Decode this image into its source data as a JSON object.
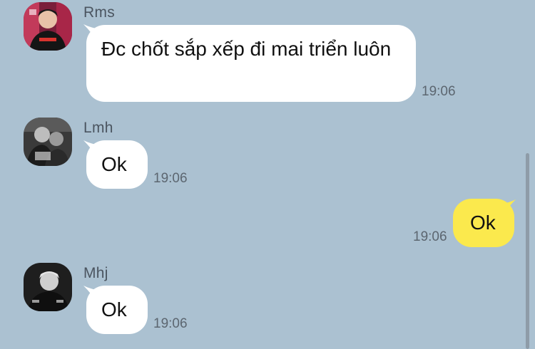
{
  "messages": [
    {
      "sender": "Rms",
      "text": "Đc chốt sắp xếp đi mai triển luôn",
      "time": "19:06",
      "direction": "incoming"
    },
    {
      "sender": "Lmh",
      "text": "Ok",
      "time": "19:06",
      "direction": "incoming"
    },
    {
      "sender": "",
      "text": "Ok",
      "time": "19:06",
      "direction": "outgoing"
    },
    {
      "sender": "Mhj",
      "text": "Ok",
      "time": "19:06",
      "direction": "incoming"
    }
  ],
  "colors": {
    "background": "#abc1d1",
    "incoming_bubble": "#ffffff",
    "outgoing_bubble": "#fbe94d"
  },
  "icons": {
    "avatar_rms": "avatar-photo",
    "avatar_lmh": "avatar-photo",
    "avatar_mhj": "avatar-photo"
  }
}
